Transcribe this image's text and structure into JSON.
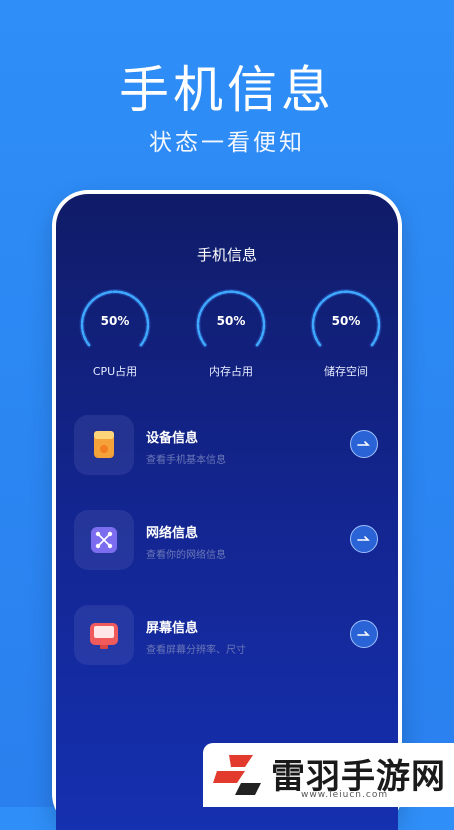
{
  "promo": {
    "title": "手机信息",
    "subtitle": "状态一看便知"
  },
  "screen": {
    "title": "手机信息",
    "gauges": [
      {
        "value_text": "50%",
        "label": "CPU占用",
        "percent": 50
      },
      {
        "value_text": "50%",
        "label": "内存占用",
        "percent": 50
      },
      {
        "value_text": "50%",
        "label": "储存空间",
        "percent": 50
      }
    ],
    "items": [
      {
        "title": "设备信息",
        "desc": "查看手机基本信息",
        "icon": "device-icon",
        "color": "#f6a23a"
      },
      {
        "title": "网络信息",
        "desc": "查看你的网络信息",
        "icon": "network-icon",
        "color": "#7b6cf0"
      },
      {
        "title": "屏幕信息",
        "desc": "查看屏幕分辨率、尺寸",
        "icon": "screen-icon",
        "color": "#f05a5a"
      }
    ]
  },
  "watermark": {
    "name": "雷羽手游网",
    "url": "www.leiucn.com"
  },
  "colors": {
    "background": "#2f8ef7",
    "screen": "#132590",
    "gauge_ring": "#3fa9ff",
    "accent_button": "#2a63d6"
  }
}
